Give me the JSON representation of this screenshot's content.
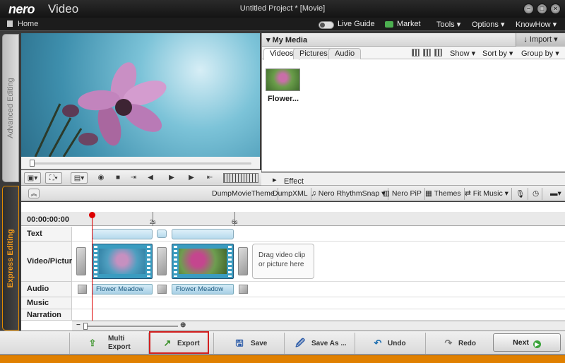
{
  "app": {
    "logo": "nero",
    "name": "Video",
    "window_title": "Untitled Project * [Movie]",
    "window_controls": [
      "minimize-icon",
      "restore-icon",
      "close-icon"
    ]
  },
  "menubar": {
    "home": "Home",
    "live_guide": "Live Guide",
    "market": "Market",
    "tools": "Tools ▾",
    "options": "Options ▾",
    "knowhow": "KnowHow ▾"
  },
  "sidebar": {
    "advanced": "Advanced Editing",
    "express": "Express Editing"
  },
  "media": {
    "title": "My Media",
    "import": "Import",
    "tabs": [
      "Videos",
      "Pictures",
      "Audio"
    ],
    "show": "Show ▾",
    "sort_by": "Sort by ▾",
    "group_by": "Group by ▾",
    "items": [
      {
        "caption": "Flower..."
      }
    ]
  },
  "effect_palette": "Effect Palette:",
  "toolbar": {
    "items": [
      "DumpMovieTheme",
      "DumpXML",
      "Nero RhythmSnap ▾",
      "Nero PiP",
      "Themes",
      "Fit Music ▾"
    ]
  },
  "timeline": {
    "timecode": "00:00:00:00",
    "ticks": [
      "2s",
      "6s"
    ],
    "tracks": [
      "Text",
      "Video/Picture",
      "Audio",
      "Music",
      "Narration"
    ],
    "dropzone": "Drag video clip or picture here",
    "audio_clips": [
      "Flower Meadow",
      "Flower Meadow"
    ]
  },
  "bottombar": {
    "multi_export": "Multi Export",
    "export": "Export",
    "save": "Save",
    "save_as": "Save As ...",
    "undo": "Undo",
    "redo": "Redo",
    "next": "Next"
  }
}
